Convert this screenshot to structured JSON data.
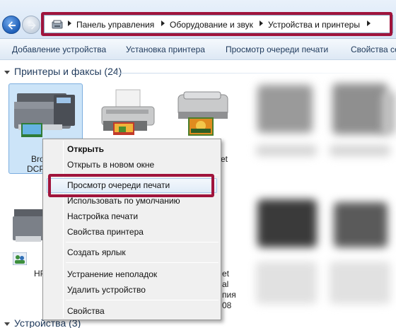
{
  "address_bar": {
    "crumbs": [
      "Панель управления",
      "Оборудование и звук",
      "Устройства и принтеры"
    ]
  },
  "command_bar": {
    "items": [
      "Добавление устройства",
      "Установка принтера",
      "Просмотр очереди печати",
      "Свойства се"
    ]
  },
  "groups": {
    "printers_header": "Принтеры и факсы (24)",
    "devices_header": "Устройства (3)"
  },
  "devices": {
    "selected_label_1": "Bro",
    "selected_label_2": "DCP",
    "row2_label": "HP",
    "inkjet_fragment": "et",
    "partial_lines": [
      "et",
      "al",
      "пия",
      "08"
    ]
  },
  "context_menu": {
    "items": [
      {
        "label": "Открыть",
        "bold": true
      },
      {
        "label": "Открыть в новом окне"
      },
      {
        "label": "Просмотр очереди печати",
        "highlighted": true
      },
      {
        "label": "Использовать по умолчанию"
      },
      {
        "label": "Настройка печати"
      },
      {
        "label": "Свойства принтера"
      },
      {
        "label": "Создать ярлык"
      },
      {
        "label": "Устранение неполадок"
      },
      {
        "label": "Удалить устройство"
      },
      {
        "label": "Свойства"
      }
    ]
  },
  "colors": {
    "highlight_frame": "#a0143c",
    "accent_text": "#1e395b"
  }
}
